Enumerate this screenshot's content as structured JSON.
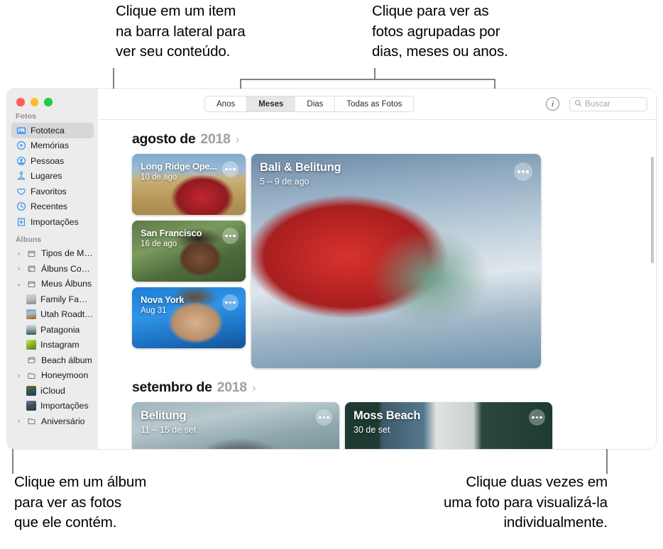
{
  "callouts": {
    "sidebar": "Clique em um item\nna barra lateral para\nver seu conteúdo.",
    "viewmode": "Clique para ver as\nfotos agrupadas por\ndias, meses ou anos.",
    "album": "Clique em um álbum\npara ver as fotos\nque ele contém.",
    "photo": "Clique duas vezes em\numa foto para visualizá-la\nindividualmente."
  },
  "window": {
    "traffic_lights": [
      {
        "name": "close",
        "color": "#ff5f57"
      },
      {
        "name": "minimize",
        "color": "#febc2e"
      },
      {
        "name": "maximize",
        "color": "#28c840"
      }
    ]
  },
  "sidebar": {
    "sections": [
      {
        "header": "Fotos",
        "items": [
          {
            "label": "Fototeca",
            "icon": "photo-library-icon",
            "selected": true
          },
          {
            "label": "Memórias",
            "icon": "memories-icon",
            "selected": false
          },
          {
            "label": "Pessoas",
            "icon": "people-icon",
            "selected": false
          },
          {
            "label": "Lugares",
            "icon": "places-pin-icon",
            "selected": false
          },
          {
            "label": "Favoritos",
            "icon": "heart-icon",
            "selected": false
          },
          {
            "label": "Recentes",
            "icon": "clock-icon",
            "selected": false
          },
          {
            "label": "Importações",
            "icon": "import-arrow-icon",
            "selected": false
          }
        ]
      },
      {
        "header": "Álbuns",
        "items": [
          {
            "label": "Tipos de Mídia",
            "icon": "folder-icon",
            "twisty": "collapsed",
            "selected": false
          },
          {
            "label": "Álbuns Comparti...",
            "icon": "shared-album-icon",
            "twisty": "collapsed",
            "selected": false
          },
          {
            "label": "Meus Álbuns",
            "icon": "folder-icon",
            "twisty": "expanded",
            "selected": false
          },
          {
            "label": "Family Family...",
            "icon": "album-thumb-family",
            "sub": true,
            "selected": false
          },
          {
            "label": "Utah Roadtrip",
            "icon": "album-thumb-utah",
            "sub": true,
            "selected": false
          },
          {
            "label": "Patagonia",
            "icon": "album-thumb-patagonia",
            "sub": true,
            "selected": false
          },
          {
            "label": "Instagram",
            "icon": "album-thumb-instagram",
            "sub": true,
            "selected": false
          },
          {
            "label": "Beach álbum",
            "icon": "album-empty-icon",
            "sub": true,
            "selected": false
          },
          {
            "label": "Honeymoon",
            "icon": "folder-open-icon",
            "sub": true,
            "twisty": "collapsed",
            "selected": false
          },
          {
            "label": "iCloud",
            "icon": "album-thumb-icloud",
            "sub": true,
            "selected": false
          },
          {
            "label": "Importações",
            "icon": "album-thumb-import",
            "sub": true,
            "selected": false
          },
          {
            "label": "Aniversário",
            "icon": "folder-open-icon",
            "sub": true,
            "twisty": "collapsed",
            "selected": false
          }
        ]
      }
    ]
  },
  "toolbar": {
    "segments": [
      {
        "label": "Anos",
        "active": false
      },
      {
        "label": "Meses",
        "active": true
      },
      {
        "label": "Dias",
        "active": false
      },
      {
        "label": "Todas as Fotos",
        "active": false
      }
    ],
    "info_label": "i",
    "search_placeholder": "Buscar",
    "search_value": ""
  },
  "content": {
    "groups": [
      {
        "month": "agosto de",
        "year": "2018",
        "chevron": "›",
        "cards": [
          {
            "title": "Long Ridge Ope...",
            "subtitle": "10 de ago",
            "photo": "ph-longridge"
          },
          {
            "title": "San Francisco",
            "subtitle": "16 de ago",
            "photo": "ph-sanfran"
          },
          {
            "title": "Nova York",
            "subtitle": "Aug 31",
            "photo": "ph-novayork"
          },
          {
            "title": "Bali & Belitung",
            "subtitle": "5 – 9 de ago",
            "photo": "ph-bali"
          }
        ]
      },
      {
        "month": "setembro de",
        "year": "2018",
        "chevron": "›",
        "cards": [
          {
            "title": "Belitung",
            "subtitle": "11 – 15 de set",
            "photo": "ph-belitung"
          },
          {
            "title": "Moss Beach",
            "subtitle": "30 de set",
            "photo": "ph-mossbeach"
          }
        ]
      }
    ]
  }
}
